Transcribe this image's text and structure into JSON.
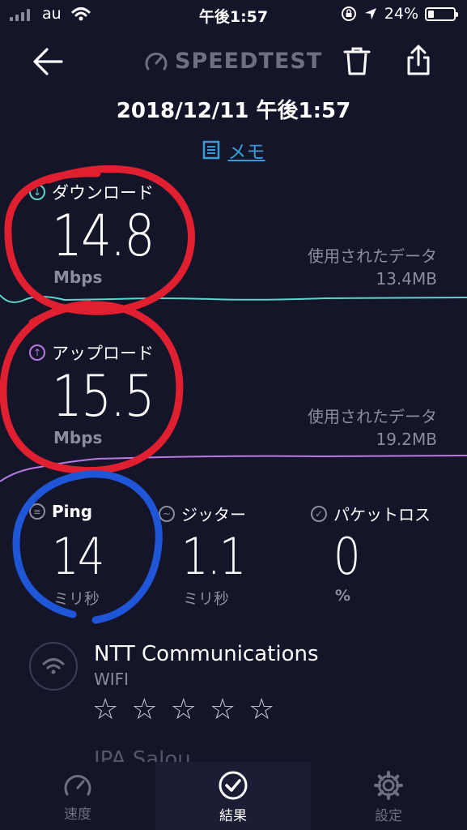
{
  "status_bar": {
    "carrier": "au",
    "time": "午後1:57",
    "battery": "24%",
    "battery_level": 0.24
  },
  "header": {
    "logo": "SPEEDTEST",
    "datetime": "2018/12/11 午後1:57",
    "memo": "メモ"
  },
  "download": {
    "label": "ダウンロード",
    "value": "14.8",
    "unit": "Mbps",
    "used_label": "使用されたデータ",
    "used_value": "13.4MB"
  },
  "upload": {
    "label": "アップロード",
    "value": "15.5",
    "unit": "Mbps",
    "used_label": "使用されたデータ",
    "used_value": "19.2MB"
  },
  "ping": {
    "label": "Ping",
    "value": "14",
    "unit": "ミリ秒"
  },
  "jitter": {
    "label": "ジッター",
    "value": "1.1",
    "unit": "ミリ秒"
  },
  "packet_loss": {
    "label": "パケットロス",
    "value": "0",
    "unit": "%"
  },
  "provider": {
    "name": "NTT Communications",
    "type": "WIFI",
    "rating_max": 5,
    "rating": 0,
    "next_partial": "IPA Salou..."
  },
  "tabs": [
    {
      "label": "速度",
      "icon": "speedometer-icon",
      "active": false
    },
    {
      "label": "結果",
      "icon": "check-circle-icon",
      "active": true
    },
    {
      "label": "設定",
      "icon": "gear-icon",
      "active": false
    }
  ],
  "colors": {
    "background": "#15152a",
    "download_accent": "#5fd3c9",
    "upload_accent": "#b67be3",
    "memo_link": "#3a9ad8",
    "annotation_red": "#e02030",
    "annotation_blue": "#1f56d8"
  }
}
